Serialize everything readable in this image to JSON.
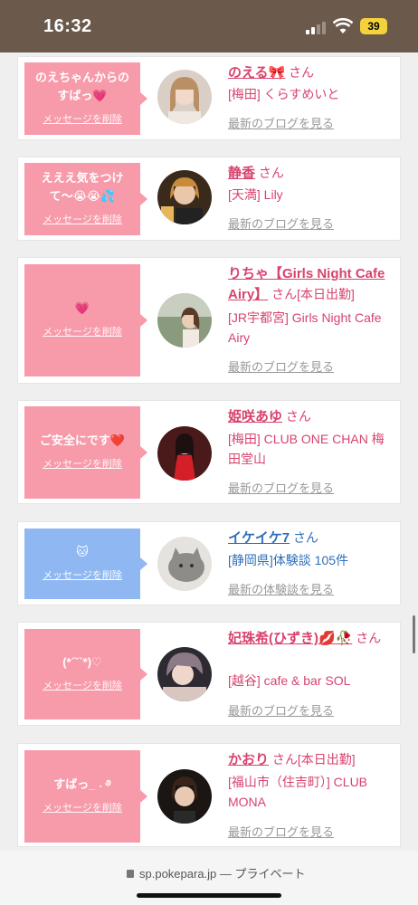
{
  "status": {
    "time": "16:32",
    "battery": "39"
  },
  "delete_label": "メッセージを削除",
  "cards": [
    {
      "message": "のえちゃんからのすばっ💗",
      "name": "のえる🎀",
      "suffix": "さん",
      "extra": "",
      "shop": "[梅田] くらすめいと",
      "link": "最新のブログを見る",
      "blue": false
    },
    {
      "message": "えええ気をつけて〜😭😭💦",
      "name": "静香",
      "suffix": "さん",
      "extra": "",
      "shop": "[天満] Lily",
      "link": "最新のブログを見る",
      "blue": false
    },
    {
      "message": "💗",
      "name": "りちゃ【Girls Night Cafe Airy】",
      "suffix": "さん",
      "extra": "[本日出勤]",
      "shop": "[JR宇都宮] Girls Night Cafe Airy",
      "link": "最新のブログを見る",
      "blue": false
    },
    {
      "message": "ご安全にです❤️",
      "name": "姫咲あゆ",
      "suffix": "さん",
      "extra": "",
      "shop": "[梅田] CLUB ONE CHAN 梅田堂山",
      "link": "最新のブログを見る",
      "blue": false
    },
    {
      "message": "🐱",
      "name": "イケイケ7",
      "suffix": "さん",
      "extra": "",
      "shop": "[静岡県]体験談 105件",
      "link": "最新の体験談を見る",
      "blue": true
    },
    {
      "message": "(*´˘`*)♡",
      "name": "妃珠希(ひずき)💋🥀",
      "suffix": "さん",
      "extra": "",
      "shop": "[越谷] cafe & bar SOL",
      "link": "最新のブログを見る",
      "blue": false
    },
    {
      "message": "すばっ_ ˖ ࿔",
      "name": "かおり",
      "suffix": "さん",
      "extra": "[本日出勤]",
      "shop": "[福山市（住吉町）] CLUB MONA",
      "link": "最新のブログを見る",
      "blue": false
    }
  ],
  "browser": {
    "url": "sp.pokepara.jp",
    "separator": "—",
    "mode": "プライベート"
  }
}
